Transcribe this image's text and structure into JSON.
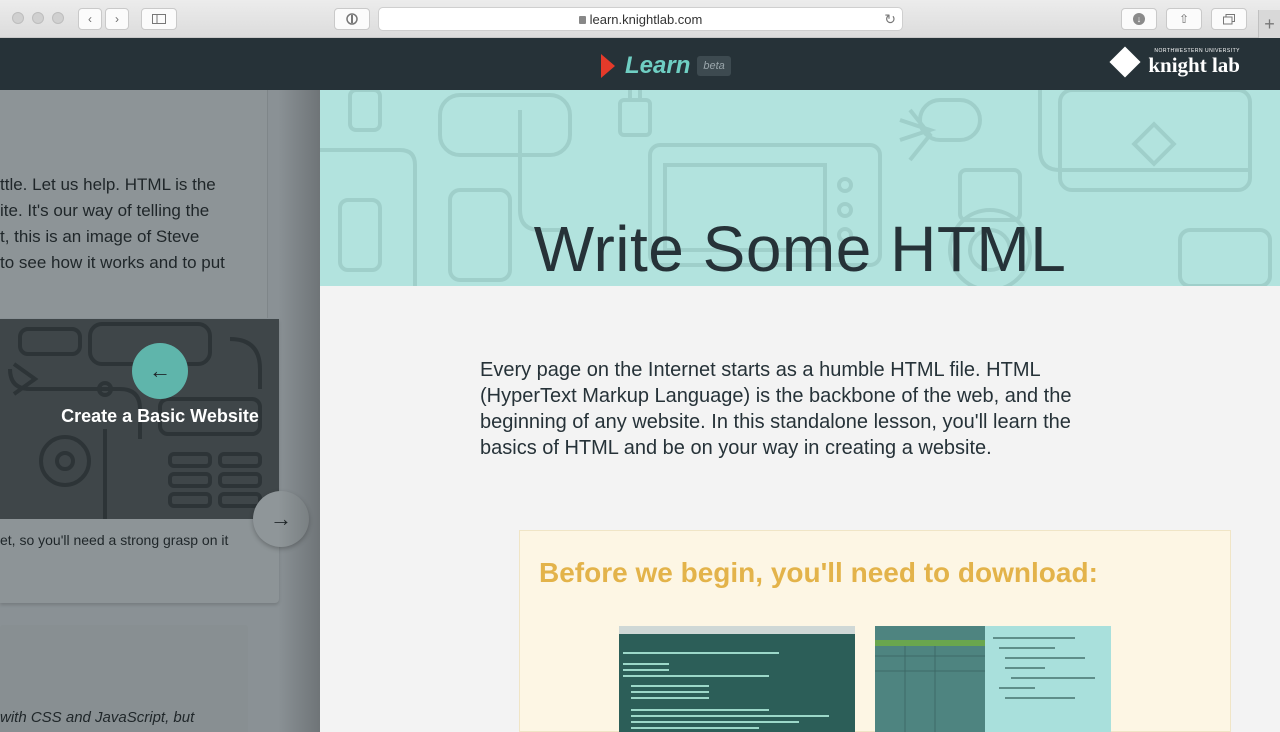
{
  "browser": {
    "url": "learn.knightlab.com"
  },
  "header": {
    "brand": "Learn",
    "badge": "beta",
    "org_small": "NORTHWESTERN UNIVERSITY",
    "org_name": "knight lab"
  },
  "left_panel": {
    "text_lines": "ttle. Let us help. HTML is the\nite. It's our way of telling the\nt, this is an image of Steve\nto see how it works and to put",
    "nav_title": "Create a Basic Website",
    "nav_desc": "et, so you'll need a strong grasp on it",
    "bottom_text": "with CSS and JavaScript, but"
  },
  "main": {
    "title": "Write Some HTML",
    "intro": "Every page on the Internet starts as a humble HTML file. HTML (HyperText Markup Language) is the backbone of the web, and the beginning of any website. In this standalone lesson, you'll learn the basics of HTML and be on your way in creating a website.",
    "download_title": "Before we begin, you'll need to download:"
  },
  "icons": [
    "back-icon",
    "forward-icon",
    "sidebar-icon",
    "shield-icon",
    "lock-icon",
    "reload-icon",
    "download-icon",
    "share-icon",
    "tabs-icon",
    "new-tab-icon",
    "arrow-left-icon",
    "arrow-right-icon"
  ],
  "colors": {
    "header_bg": "#263238",
    "brand_teal": "#6fcfc3",
    "hero_bg": "#b2e3de",
    "download_title": "#e3b34a"
  }
}
